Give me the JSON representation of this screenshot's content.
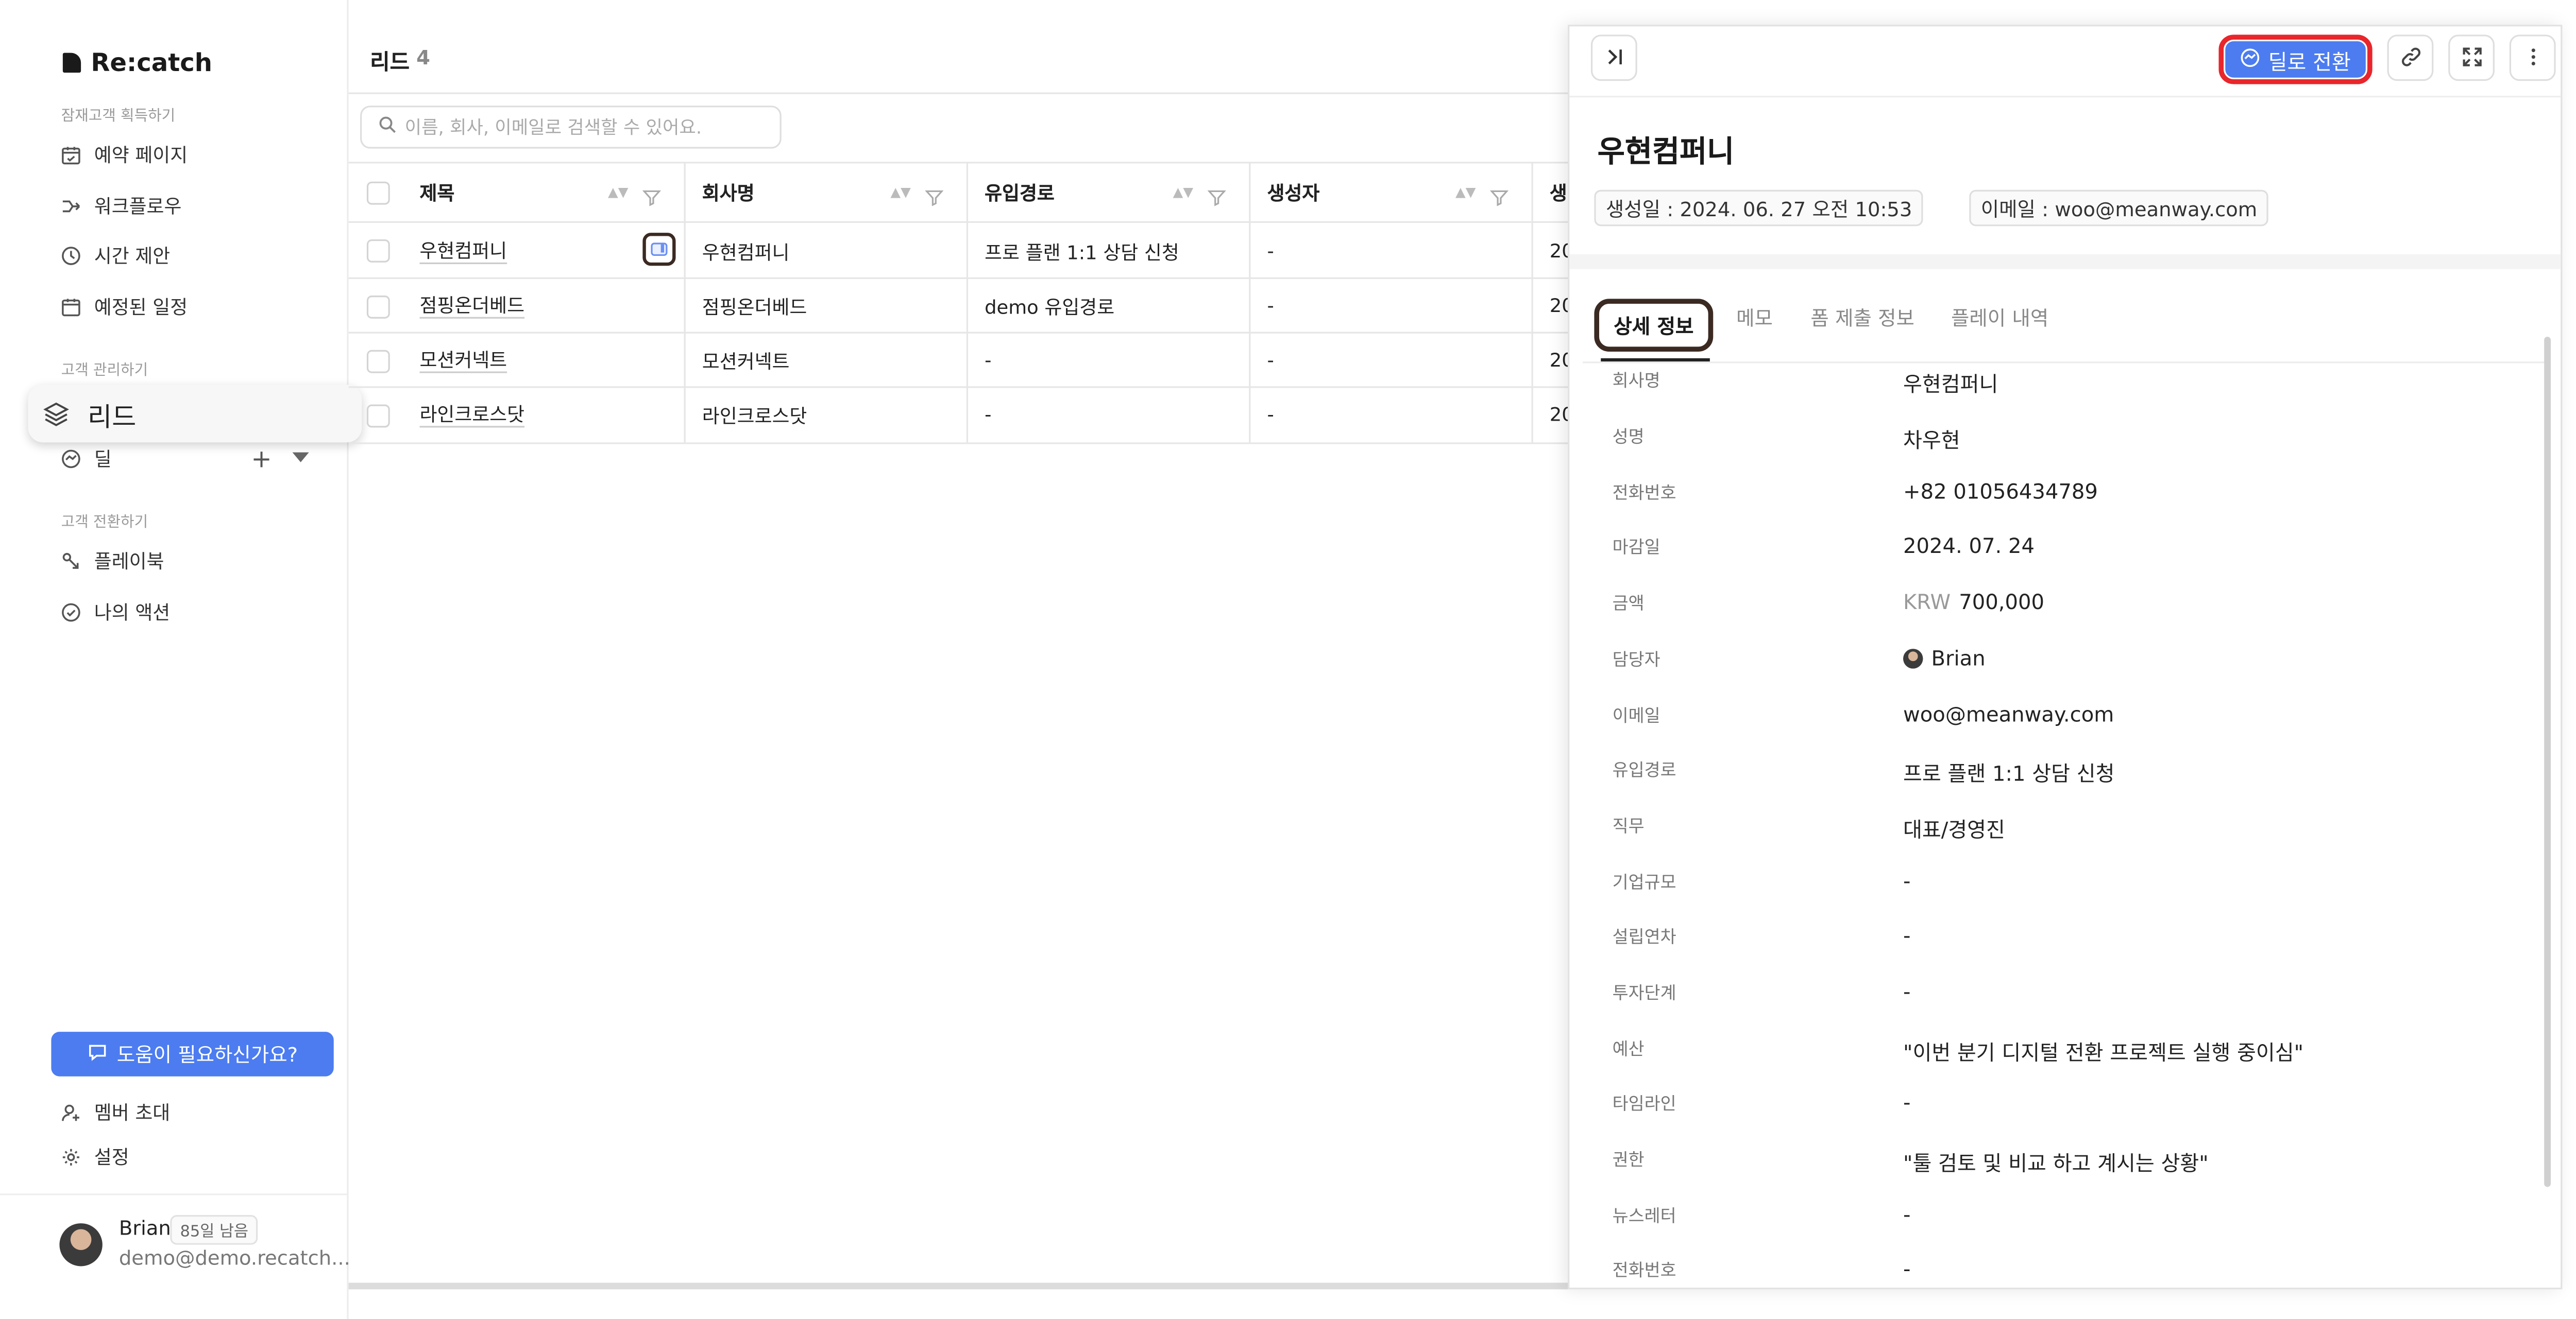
{
  "sidebar": {
    "logo": "Re:catch",
    "sections": [
      {
        "title": "잠재고객 획득하기"
      },
      {
        "title": "고객 관리하기"
      },
      {
        "title": "고객 전환하기"
      }
    ],
    "items": [
      {
        "label": "예약 페이지",
        "icon": "calendar-check-icon"
      },
      {
        "label": "워크플로우",
        "icon": "workflow-icon"
      },
      {
        "label": "시간 제안",
        "icon": "clock-icon"
      },
      {
        "label": "예정된 일정",
        "icon": "calendar-icon"
      },
      {
        "label": "리드",
        "icon": "layers-icon"
      },
      {
        "label": "딜",
        "icon": "handshake-icon"
      },
      {
        "label": "플레이북",
        "icon": "playbook-icon"
      },
      {
        "label": "나의 액션",
        "icon": "check-circle-icon"
      }
    ],
    "help_label": "도움이 필요하신가요?",
    "invite_label": "멤버 초대",
    "settings_label": "설정",
    "user": {
      "name": "Brian",
      "trial": "85일 남음",
      "email": "demo@demo.recatch..."
    }
  },
  "main": {
    "title": "리드",
    "count": "4",
    "search_placeholder": "이름, 회사, 이메일로 검색할 수 있어요.",
    "columns": [
      "제목",
      "회사명",
      "유입경로",
      "생성자",
      "생"
    ],
    "rows": [
      {
        "title": "우현컴퍼니",
        "company": "우현컴퍼니",
        "source": "프로 플랜 1:1 상담 신청",
        "creator": "-",
        "created": "20"
      },
      {
        "title": "점핑온더베드",
        "company": "점핑온더베드",
        "source": "demo 유입경로",
        "creator": "-",
        "created": "20"
      },
      {
        "title": "모션커넥트",
        "company": "모션커넥트",
        "source": "-",
        "creator": "-",
        "created": "20"
      },
      {
        "title": "라인크로스닷",
        "company": "라인크로스닷",
        "source": "-",
        "creator": "-",
        "created": "20"
      }
    ]
  },
  "panel": {
    "convert_label": "딜로 전환",
    "title": "우현컴퍼니",
    "created_tag": "생성일 : 2024. 06. 27 오전 10:53",
    "email_tag": "이메일 : woo@meanway.com",
    "tabs": [
      "상세 정보",
      "메모",
      "폼 제출 정보",
      "플레이 내역"
    ],
    "fields": [
      {
        "label": "회사명",
        "value": "우현컴퍼니"
      },
      {
        "label": "성명",
        "value": "차우현"
      },
      {
        "label": "전화번호",
        "value": "+82 01056434789"
      },
      {
        "label": "마감일",
        "value": "2024. 07. 24"
      },
      {
        "label": "금액",
        "value": "700,000"
      },
      {
        "label": "담당자",
        "value": "Brian"
      },
      {
        "label": "이메일",
        "value": "woo@meanway.com"
      },
      {
        "label": "유입경로",
        "value": "프로 플랜 1:1 상담 신청"
      },
      {
        "label": "직무",
        "value": "대표/경영진"
      },
      {
        "label": "기업규모",
        "value": "-"
      },
      {
        "label": "설립연차",
        "value": "-"
      },
      {
        "label": "투자단계",
        "value": "-"
      },
      {
        "label": "예산",
        "value": "\"이번 분기 디지털 전환 프로젝트 실행 중이심\""
      },
      {
        "label": "타임라인",
        "value": "-"
      },
      {
        "label": "권한",
        "value": "\"툴 검토 및 비교 하고 계시는 상황\""
      },
      {
        "label": "뉴스레터",
        "value": "-"
      },
      {
        "label": "전화번호",
        "value": "-"
      }
    ],
    "amount_currency": "KRW"
  },
  "colors": {
    "accent": "#4c7cf0",
    "highlight_red": "#e8262b",
    "highlight_dark": "#3b2a22"
  }
}
